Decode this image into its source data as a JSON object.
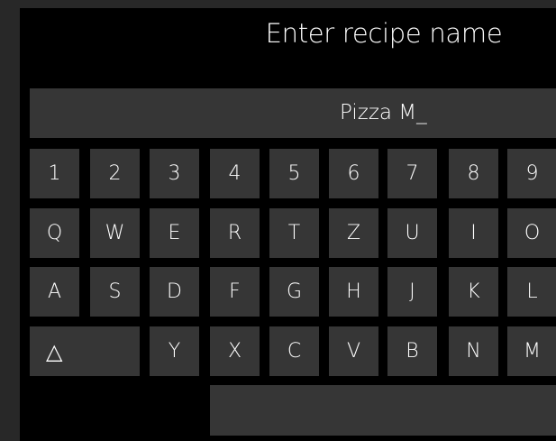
{
  "title": "Enter recipe name",
  "input": {
    "value": "Pizza M_"
  },
  "keyboard": {
    "rows": [
      [
        "1",
        "2",
        "3",
        "4",
        "5",
        "6",
        "7",
        "8",
        "9"
      ],
      [
        "Q",
        "W",
        "E",
        "R",
        "T",
        "Z",
        "U",
        "I",
        "O"
      ],
      [
        "A",
        "S",
        "D",
        "F",
        "G",
        "H",
        "J",
        "K",
        "L"
      ]
    ],
    "bottom_row": [
      "Y",
      "X",
      "C",
      "V",
      "B",
      "N",
      "M"
    ],
    "shift_key": "△"
  }
}
